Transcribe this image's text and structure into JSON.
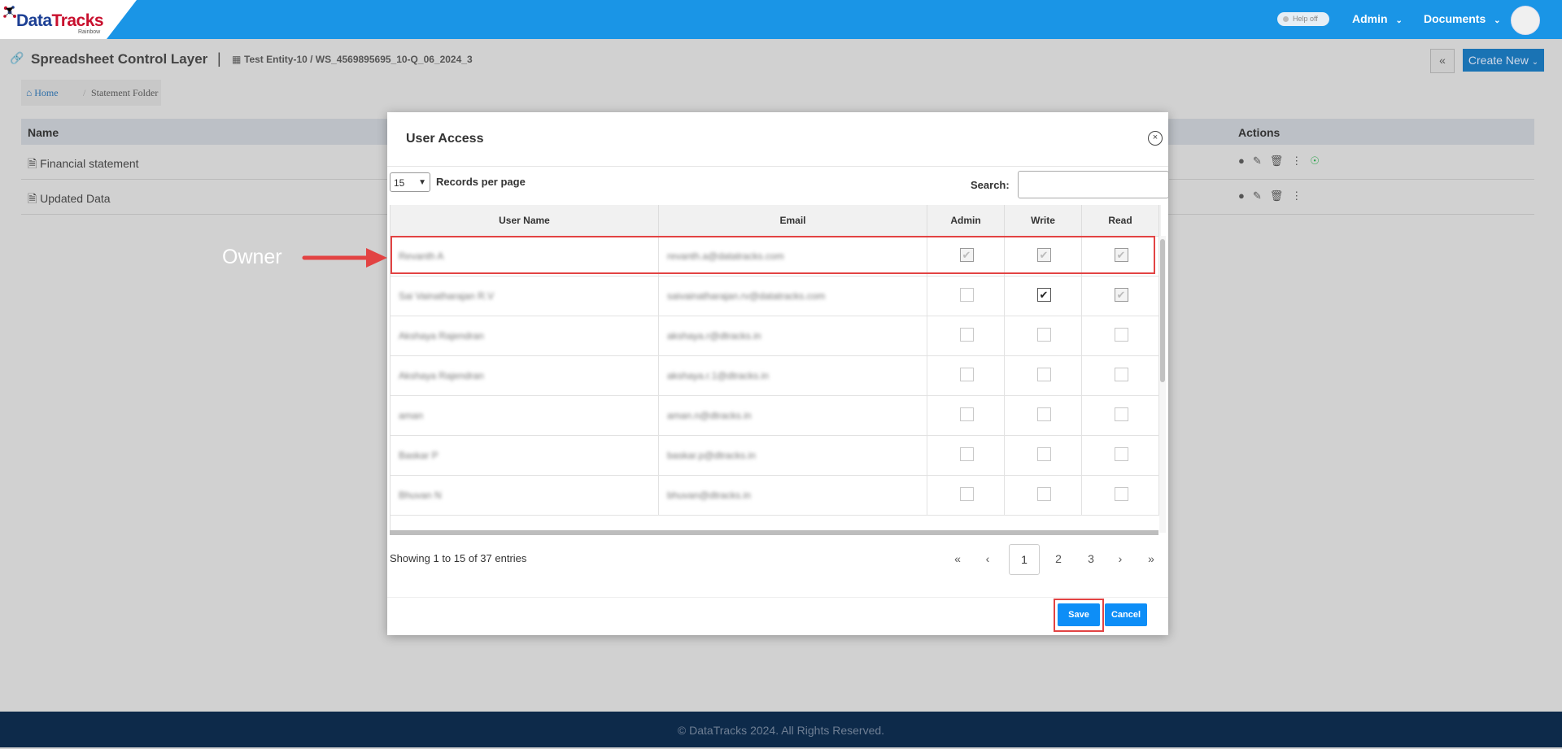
{
  "header": {
    "logo_main": "Data",
    "logo_accent": "Tracks",
    "logo_sub": "Rainbow",
    "help_toggle": "Help off",
    "admin_menu": "Admin",
    "documents_menu": "Documents"
  },
  "page": {
    "title": "Spreadsheet Control Layer",
    "separator": "|",
    "entity_path": "Test Entity-10 / WS_4569895695_10-Q_06_2024_3",
    "create_new": "Create New",
    "breadcrumb": {
      "home": "Home",
      "current": "Statement Folder"
    },
    "table": {
      "name_header": "Name",
      "actions_header": "Actions",
      "rows": [
        "Financial statement",
        "Updated Data"
      ]
    }
  },
  "modal": {
    "title": "User Access",
    "records_per_page": "15",
    "records_per_page_label": "Records per page",
    "search_label": "Search:",
    "search_value": "",
    "columns": [
      "User Name",
      "Email",
      "Admin",
      "Write",
      "Read"
    ],
    "rows": [
      {
        "user": "Revanth A",
        "email": "revanth.a@datatracks.com",
        "admin": true,
        "write": true,
        "read": true,
        "state": "dim"
      },
      {
        "user": "Sai Vainatharajan R.V",
        "email": "saivainatharajan.rv@datatracks.com",
        "admin": false,
        "write": true,
        "read": true,
        "state": "mixed"
      },
      {
        "user": "Akshaya Rajendran",
        "email": "akshaya.r@dtracks.in",
        "admin": false,
        "write": false,
        "read": false,
        "state": "off"
      },
      {
        "user": "Akshaya Rajendran",
        "email": "akshaya.r.1@dtracks.in",
        "admin": false,
        "write": false,
        "read": false,
        "state": "off"
      },
      {
        "user": "aman",
        "email": "aman.n@dtracks.in",
        "admin": false,
        "write": false,
        "read": false,
        "state": "off"
      },
      {
        "user": "Baskar P",
        "email": "baskar.p@dtracks.in",
        "admin": false,
        "write": false,
        "read": false,
        "state": "off"
      },
      {
        "user": "Bhuvan N",
        "email": "bhuvan@dtracks.in",
        "admin": false,
        "write": false,
        "read": false,
        "state": "off"
      }
    ],
    "info": "Showing 1 to 15 of 37 entries",
    "pagination": [
      "«",
      "‹",
      "1",
      "2",
      "3",
      "›",
      "»"
    ],
    "current_page": "1",
    "save": "Save",
    "cancel": "Cancel"
  },
  "annotation": {
    "owner_label": "Owner",
    "arrow_color": "#e24343"
  },
  "footer": {
    "copyright": "© DataTracks 2024. All Rights Reserved."
  },
  "colors": {
    "topbar": "#1a95e6",
    "primary_button": "#0d8ef7",
    "highlight": "#e24343",
    "footer": "#0d2a4a"
  }
}
